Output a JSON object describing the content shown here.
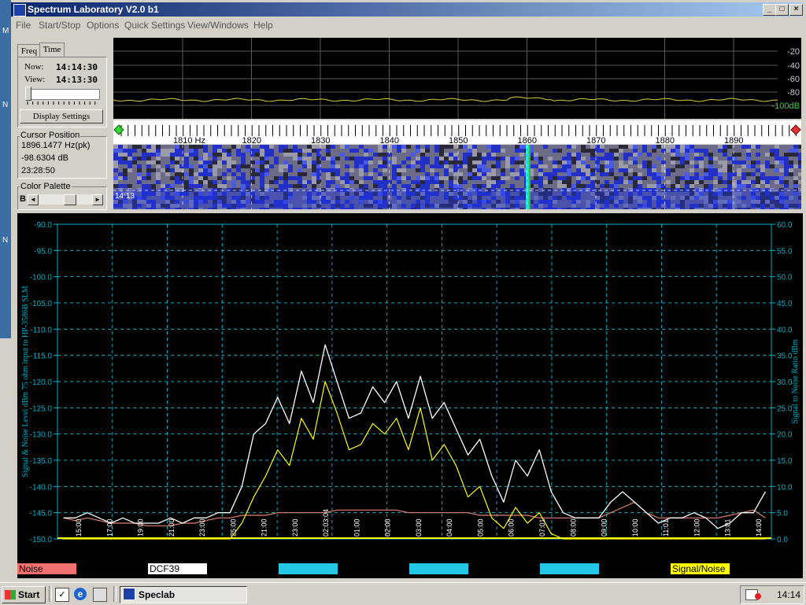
{
  "window": {
    "title": "Spectrum Laboratory V2.0 b1",
    "minimize_label": "_",
    "maximize_label": "□",
    "close_label": "×"
  },
  "menu": [
    "File",
    "Start/Stop",
    "Options",
    "Quick Settings",
    "View/Windows",
    "Help"
  ],
  "desktop_strip_letters": [
    "M",
    "N",
    "N"
  ],
  "left_panel": {
    "tabs": [
      "Freq",
      "Time"
    ],
    "now_label": "Now:",
    "now_value": "14:14:30",
    "view_label": "View:",
    "view_value": "14:13:30",
    "display_settings_label": "Display Settings",
    "cursor_title": "Cursor Position",
    "cursor_freq": "1896.1477 Hz(pk)",
    "cursor_level": "-98.6304 dB",
    "cursor_time": "23:28:50",
    "palette_title": "Color Palette",
    "palette_letter": "B",
    "palette_left_arrow": "◄",
    "palette_right_arrow": "►"
  },
  "spectrum": {
    "db_labels": [
      "-20",
      "-40",
      "-60",
      "-80",
      "-100dB"
    ],
    "freq_labels": [
      "1810 Hz",
      "1820",
      "1830",
      "1840",
      "1850",
      "1860",
      "1870",
      "1880",
      "1890"
    ]
  },
  "waterfall": {
    "time_label": "14:13"
  },
  "chart_data": {
    "type": "line",
    "ylabel": "Signal & Noise Level  dBm 75 ohm input to HP-3586B SLM",
    "y2label": "Signal to Noise Ratio  dBm",
    "ylim": [
      -150,
      -90
    ],
    "y2lim": [
      0,
      60
    ],
    "yticks": [
      "-90.0",
      "-95.0",
      "-100.0",
      "-105.0",
      "-110.0",
      "-115.0",
      "-120.0",
      "-125.0",
      "-130.0",
      "-135.0",
      "-140.0",
      "-145.0",
      "-150.0"
    ],
    "y2ticks": [
      "60.0",
      "55.0",
      "50.0",
      "45.0",
      "40.0",
      "35.0",
      "30.0",
      "25.0",
      "20.0",
      "15.0",
      "10.0",
      "5.0",
      "0.0"
    ],
    "xticks": [
      "15:00",
      "17:00",
      "19:00",
      "21:00",
      "23:00",
      "25:00",
      "21:00",
      "23:00",
      "02:03:04",
      "01:00",
      "02:00",
      "03:00",
      "04:00",
      "05:00",
      "06:00",
      "07:01",
      "08:00",
      "09:00",
      "10:00",
      "11:01",
      "12:00",
      "13:01",
      "14:00"
    ],
    "series": [
      {
        "name": "Noise",
        "color": "#e08070",
        "values": [
          -146,
          -146.5,
          -146,
          -146.5,
          -147,
          -147,
          -147,
          -147.5,
          -147.5,
          -147.5,
          -147,
          -147,
          -146.5,
          -146,
          -146,
          -145.5,
          -145.5,
          -145.5,
          -145,
          -145,
          -145,
          -145,
          -145,
          -144.5,
          -144.5,
          -144.5,
          -144.5,
          -144.5,
          -144.5,
          -145,
          -145,
          -145,
          -145,
          -145,
          -145,
          -145.5,
          -145.5,
          -145.5,
          -145.5,
          -145.5,
          -146,
          -146,
          -146,
          -146,
          -146,
          -146,
          -145,
          -144,
          -143,
          -145,
          -146,
          -146,
          -146,
          -146,
          -146,
          -146,
          -145.5,
          -145,
          -144.5,
          -146
        ]
      },
      {
        "name": "DCF39",
        "color": "#ffffff",
        "values": [
          -146,
          -146,
          -145,
          -146,
          -147,
          -146,
          -147,
          -147,
          -147,
          -146,
          -147,
          -146,
          -146,
          -145,
          -145,
          -140,
          -130,
          -128,
          -123,
          -128,
          -118,
          -124,
          -113,
          -120,
          -127,
          -126,
          -121,
          -124,
          -120,
          -127,
          -119,
          -127,
          -124,
          -129,
          -134,
          -131,
          -138,
          -143,
          -135,
          -138,
          -133,
          -141,
          -145,
          -146,
          -146,
          -146,
          -143,
          -141,
          -143,
          -145,
          -147,
          -146,
          -146,
          -145,
          -146,
          -148,
          -147,
          -145,
          -145,
          -141
        ]
      },
      {
        "name": "Signal/Noise",
        "color": "#ffff00",
        "values": [
          0,
          0,
          0,
          0,
          0,
          0,
          0,
          0,
          0,
          0,
          0,
          0,
          0,
          0,
          0,
          3,
          8,
          12,
          17,
          14,
          23,
          19,
          30,
          24,
          17,
          18,
          22,
          20,
          23,
          17,
          25,
          15,
          18,
          14,
          8,
          10,
          4,
          2,
          6,
          3,
          5,
          1,
          0,
          0,
          0,
          0,
          0,
          0,
          0,
          0,
          0,
          0,
          0,
          0,
          0,
          0,
          0,
          0,
          0,
          0
        ]
      }
    ],
    "legend": [
      {
        "label": "Noise",
        "color": "#f07070",
        "text_color": "#000000"
      },
      {
        "label": "DCF39",
        "color": "#ffffff",
        "text_color": "#000000"
      },
      {
        "label": "",
        "color": "#22c8e6",
        "text_color": "#000000"
      },
      {
        "label": "",
        "color": "#22c8e6",
        "text_color": "#000000"
      },
      {
        "label": "",
        "color": "#22c8e6",
        "text_color": "#000000"
      },
      {
        "label": "Signal/Noise",
        "color": "#ffff00",
        "text_color": "#000000"
      }
    ],
    "grid": true,
    "axis_color": "#00b0c8"
  },
  "taskbar": {
    "start_label": "Start",
    "task_label": "Speclab",
    "clock": "14:14"
  }
}
